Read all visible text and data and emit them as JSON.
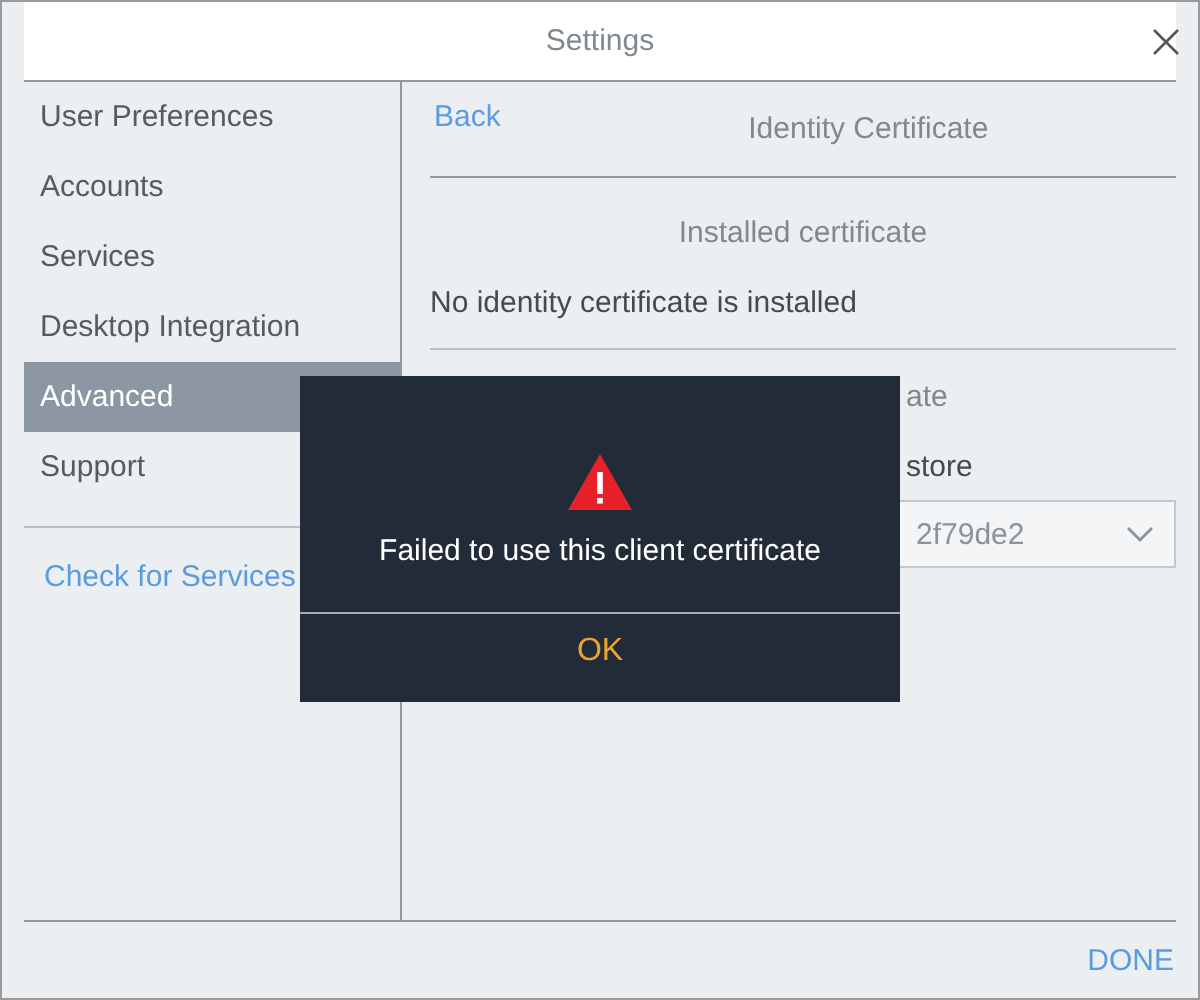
{
  "window": {
    "title": "Settings"
  },
  "sidebar": {
    "items": [
      {
        "label": "User Preferences",
        "selected": false
      },
      {
        "label": "Accounts",
        "selected": false
      },
      {
        "label": "Services",
        "selected": false
      },
      {
        "label": "Desktop Integration",
        "selected": false
      },
      {
        "label": "Advanced",
        "selected": true
      },
      {
        "label": "Support",
        "selected": false
      }
    ],
    "link": "Check for Services"
  },
  "content": {
    "back": "Back",
    "title": "Identity Certificate",
    "installed": {
      "heading": "Installed certificate",
      "status": "No identity certificate is installed"
    },
    "install": {
      "heading": "ate",
      "store_label": "store",
      "store_value": "2f79de2"
    }
  },
  "footer": {
    "done": "DONE"
  },
  "dialog": {
    "message": "Failed to use this client certificate",
    "button": "OK"
  }
}
